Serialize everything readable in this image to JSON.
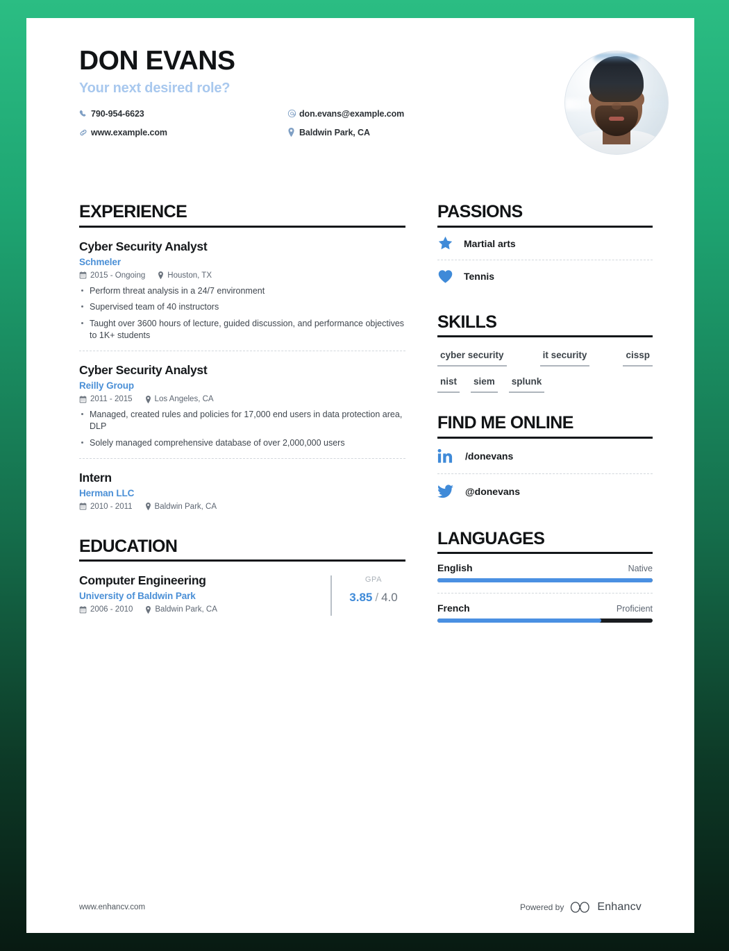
{
  "header": {
    "name": "DON EVANS",
    "subtitle": "Your next desired role?",
    "contacts_left": [
      {
        "icon": "phone-icon",
        "text": "790-954-6623"
      },
      {
        "icon": "link-icon",
        "text": "www.example.com"
      }
    ],
    "contacts_right": [
      {
        "icon": "at-icon",
        "text": "don.evans@example.com"
      },
      {
        "icon": "map-pin-icon",
        "text": "Baldwin Park, CA"
      }
    ],
    "photo_alt": "profile-photo"
  },
  "experience": {
    "title": "EXPERIENCE",
    "entries": [
      {
        "role": "Cyber Security Analyst",
        "org": "Schmeler",
        "dates": "2015 - Ongoing",
        "location": "Houston, TX",
        "bullets": [
          "Perform threat analysis in a 24/7 environment",
          "Supervised team of 40 instructors",
          "Taught over 3600 hours of lecture, guided discussion, and performance objectives to 1K+ students"
        ]
      },
      {
        "role": "Cyber Security Analyst",
        "org": "Reilly Group",
        "dates": "2011 - 2015",
        "location": "Los Angeles, CA",
        "bullets": [
          "Managed, created rules and policies for 17,000 end users in data protection area, DLP",
          "Solely managed comprehensive database of over 2,000,000 users"
        ]
      },
      {
        "role": "Intern",
        "org": "Herman LLC",
        "dates": "2010 - 2011",
        "location": "Baldwin Park, CA",
        "bullets": []
      }
    ]
  },
  "education": {
    "title": "EDUCATION",
    "entries": [
      {
        "degree": "Computer Engineering",
        "school": "University of Baldwin Park",
        "dates": "2006 - 2010",
        "location": "Baldwin Park, CA",
        "gpa_label": "GPA",
        "gpa_score": "3.85",
        "gpa_slash": "/",
        "gpa_max": "4.0"
      }
    ]
  },
  "passions": {
    "title": "PASSIONS",
    "items": [
      {
        "icon": "star-icon",
        "label": "Martial arts"
      },
      {
        "icon": "heart-icon",
        "label": "Tennis"
      }
    ]
  },
  "skills": {
    "title": "SKILLS",
    "row1": [
      "cyber security",
      "it security",
      "cissp"
    ],
    "row2": [
      "nist",
      "siem",
      "splunk"
    ]
  },
  "online": {
    "title": "FIND ME ONLINE",
    "items": [
      {
        "icon": "linkedin-icon",
        "label": "/donevans"
      },
      {
        "icon": "twitter-icon",
        "label": "@donevans"
      }
    ]
  },
  "languages": {
    "title": "LANGUAGES",
    "items": [
      {
        "name": "English",
        "level": "Native",
        "percent": 100
      },
      {
        "name": "French",
        "level": "Proficient",
        "percent": 76
      }
    ]
  },
  "footer": {
    "url": "www.enhancv.com",
    "powered_by": "Powered by",
    "brand": "Enhancv"
  },
  "colors": {
    "accent_blue": "#4a90e2",
    "org_blue": "#4a8fd6",
    "subtitle_blue": "#a8c8ee",
    "heading_black": "#111315",
    "bg_green_top": "#2bbd83",
    "bg_green_bottom": "#081a12"
  }
}
